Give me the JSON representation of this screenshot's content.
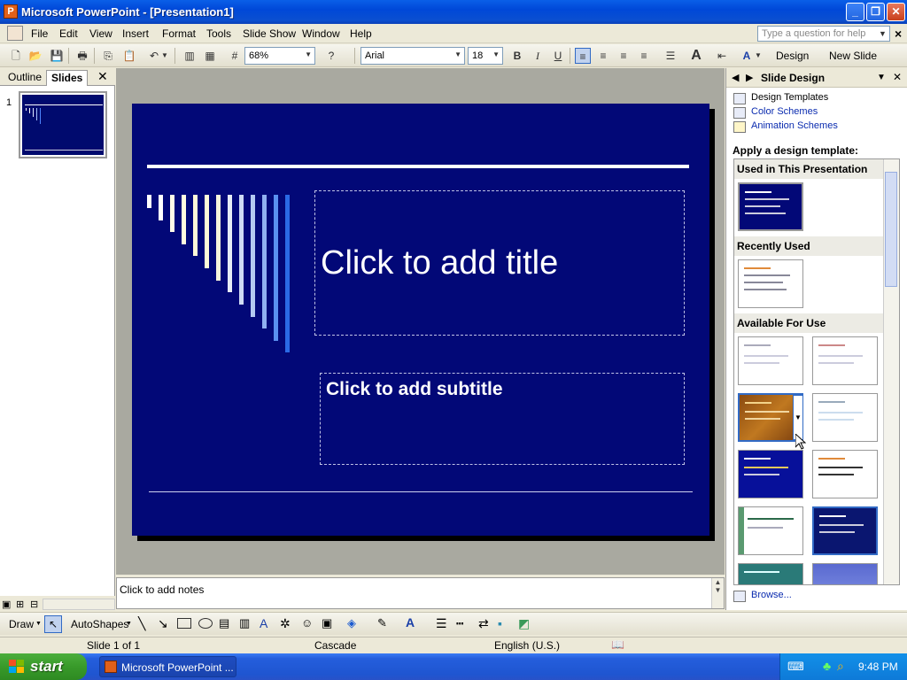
{
  "window": {
    "title": "Microsoft PowerPoint - [Presentation1]"
  },
  "menu": {
    "items": [
      "File",
      "Edit",
      "View",
      "Insert",
      "Format",
      "Tools",
      "Slide Show",
      "Window",
      "Help"
    ],
    "help_placeholder": "Type a question for help"
  },
  "toolbar": {
    "zoom": "68%",
    "font": "Arial",
    "font_size": "18",
    "design_label": "Design",
    "new_slide_label": "New Slide"
  },
  "left_pane": {
    "tabs": [
      "Outline",
      "Slides"
    ],
    "active_tab": "Slides",
    "thumb_number": "1"
  },
  "slide": {
    "title_placeholder": "Click to add title",
    "subtitle_placeholder": "Click to add subtitle",
    "background": "#020877"
  },
  "notes": {
    "placeholder": "Click to add notes"
  },
  "task_pane": {
    "title": "Slide Design",
    "links": [
      "Design Templates",
      "Color Schemes",
      "Animation Schemes"
    ],
    "apply_label": "Apply a design template:",
    "sections": [
      "Used in This Presentation",
      "Recently Used",
      "Available For Use"
    ],
    "browse_label": "Browse..."
  },
  "draw_toolbar": {
    "draw_label": "Draw",
    "autoshapes_label": "AutoShapes"
  },
  "status": {
    "slide": "Slide 1 of 1",
    "design": "Cascade",
    "language": "English (U.S.)"
  },
  "taskbar": {
    "start_label": "start",
    "app_button": "Microsoft PowerPoint ...",
    "clock": "9:48 PM"
  }
}
